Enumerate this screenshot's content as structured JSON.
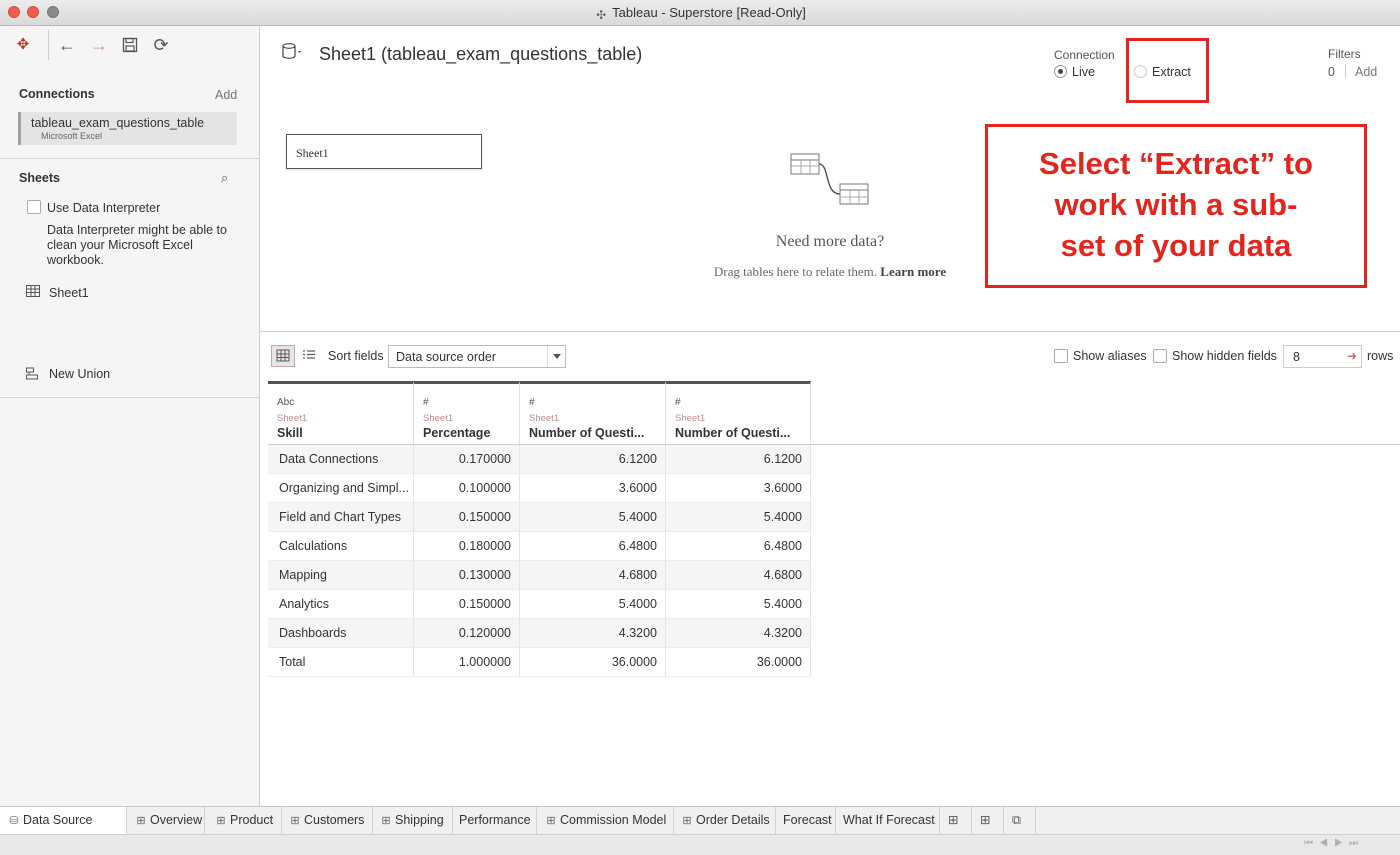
{
  "window": {
    "title": "Tableau - Superstore [Read-Only]"
  },
  "left_panel": {
    "connections_title": "Connections",
    "connections_add": "Add",
    "connection": {
      "name": "tableau_exam_questions_table",
      "type": "Microsoft Excel"
    },
    "sheets_title": "Sheets",
    "use_interpreter_label": "Use Data Interpreter",
    "interpreter_note": "Data Interpreter might be able to clean your Microsoft Excel workbook.",
    "sheet_item": "Sheet1",
    "new_union": "New Union"
  },
  "header": {
    "title": "Sheet1 (tableau_exam_questions_table)",
    "connection_label": "Connection",
    "live_label": "Live",
    "extract_label": "Extract",
    "selected_connection": "Live",
    "filters_label": "Filters",
    "filters_count": "0",
    "filters_add": "Add"
  },
  "canvas": {
    "sheet_box": "Sheet1",
    "need_more": "Need more data?",
    "drag_text": "Drag tables here to relate them.",
    "learn_more": "Learn more"
  },
  "callout": {
    "lines": [
      "Select “Extract” to",
      "work with a sub-",
      "set of your data"
    ]
  },
  "grid_toolbar": {
    "sort_label": "Sort fields",
    "sort_value": "Data source order",
    "show_aliases": "Show aliases",
    "show_hidden": "Show hidden fields",
    "rows_value": "8",
    "rows_label": "rows"
  },
  "table": {
    "columns": [
      {
        "type": "Abc",
        "source": "Sheet1",
        "name": "Skill"
      },
      {
        "type": "#",
        "source": "Sheet1",
        "name": "Percentage"
      },
      {
        "type": "#",
        "source": "Sheet1",
        "name": "Number of Questi..."
      },
      {
        "type": "#",
        "source": "Sheet1",
        "name": "Number of Questi..."
      }
    ],
    "rows": [
      [
        "Data Connections",
        "0.170000",
        "6.1200",
        "6.1200"
      ],
      [
        "Organizing and Simpl...",
        "0.100000",
        "3.6000",
        "3.6000"
      ],
      [
        "Field and Chart Types",
        "0.150000",
        "5.4000",
        "5.4000"
      ],
      [
        "Calculations",
        "0.180000",
        "6.4800",
        "6.4800"
      ],
      [
        "Mapping",
        "0.130000",
        "4.6800",
        "4.6800"
      ],
      [
        "Analytics",
        "0.150000",
        "5.4000",
        "5.4000"
      ],
      [
        "Dashboards",
        "0.120000",
        "4.3200",
        "4.3200"
      ],
      [
        "Total",
        "1.000000",
        "36.0000",
        "36.0000"
      ]
    ]
  },
  "tabs": [
    {
      "label": "Data Source",
      "icon": "database-icon",
      "active": true
    },
    {
      "label": "Overview",
      "icon": "grid-icon"
    },
    {
      "label": "Product",
      "icon": "grid-icon"
    },
    {
      "label": "Customers",
      "icon": "grid-icon"
    },
    {
      "label": "Shipping",
      "icon": "grid-icon"
    },
    {
      "label": "Performance",
      "icon": ""
    },
    {
      "label": "Commission Model",
      "icon": "grid-icon"
    },
    {
      "label": "Order Details",
      "icon": "grid-icon"
    },
    {
      "label": "Forecast",
      "icon": ""
    },
    {
      "label": "What If Forecast",
      "icon": ""
    }
  ],
  "colors": {
    "accent_red": "#e3251d"
  }
}
